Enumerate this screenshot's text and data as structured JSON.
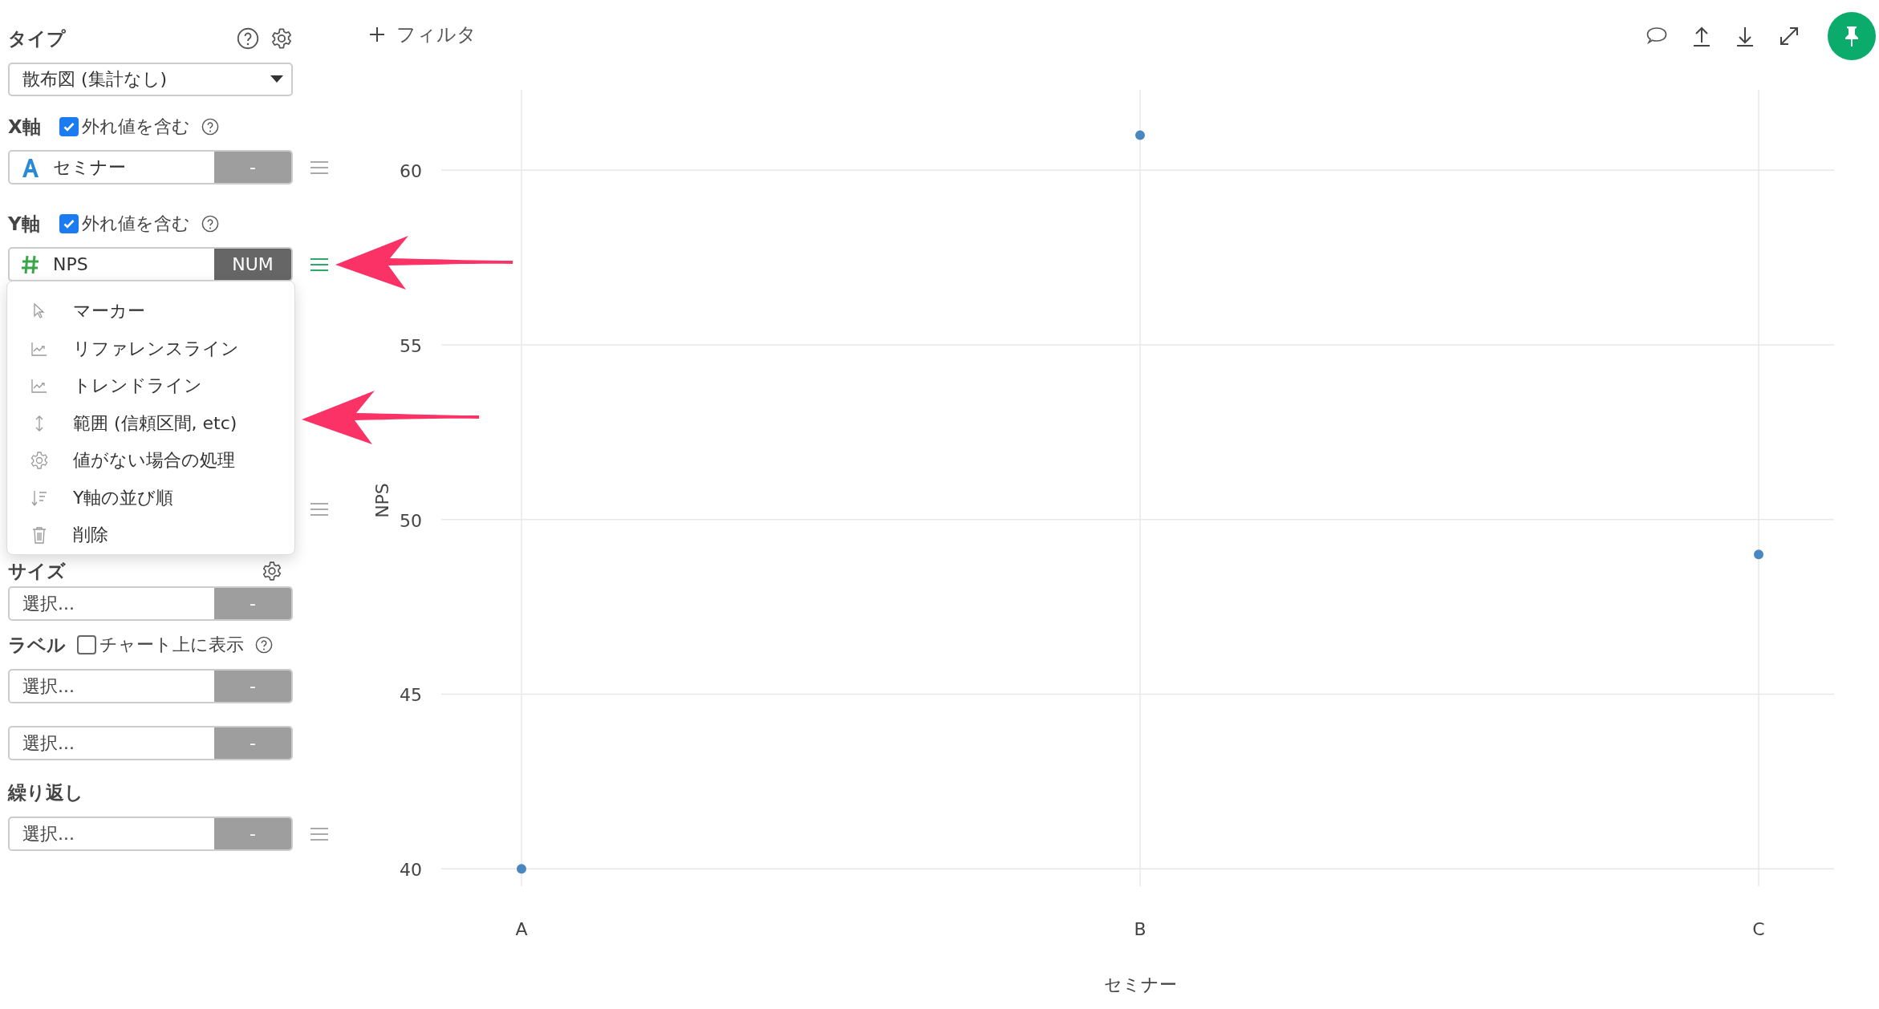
{
  "sidebar": {
    "sections": [
      {
        "kind": "type",
        "title": "タイプ",
        "dropdown": "散布図 (集計なし)"
      },
      {
        "kind": "axis",
        "title": "X軸",
        "checkbox": {
          "label": "外れ値を含む",
          "checked": true
        },
        "fields": [
          {
            "kind": "text",
            "value": "セミナー",
            "tag": "-",
            "selected": false
          }
        ]
      },
      {
        "kind": "axis",
        "title": "Y軸",
        "checkbox": {
          "label": "外れ値を含む",
          "checked": true
        },
        "fields": [
          {
            "kind": "number",
            "value": "NPS",
            "tag": "NUM",
            "selected": true
          }
        ]
      },
      {
        "kind": "size",
        "title": "サイズ",
        "fields": [
          {
            "placeholder": "選択...",
            "tag": "-",
            "selected": false
          }
        ]
      },
      {
        "kind": "label",
        "title": "ラベル",
        "checkbox": {
          "label": "チャート上に表示",
          "checked": false
        },
        "fields": [
          {
            "placeholder": "選択...",
            "tag": "-",
            "selected": false
          },
          {
            "placeholder": "選択...",
            "tag": "-",
            "selected": false
          }
        ]
      },
      {
        "kind": "repeat",
        "title": "繰り返し",
        "fields": [
          {
            "placeholder": "選択...",
            "tag": "-",
            "selected": false
          }
        ]
      }
    ]
  },
  "menu": {
    "items": [
      {
        "kind": "pointer",
        "label": "マーカー"
      },
      {
        "kind": "chart",
        "label": "リファレンスライン"
      },
      {
        "kind": "chart",
        "label": "トレンドライン"
      },
      {
        "kind": "range",
        "label": "範囲 (信頼区間, etc)"
      },
      {
        "kind": "gear",
        "label": "値がない場合の処理"
      },
      {
        "kind": "sort",
        "label": "Y軸の並び順"
      },
      {
        "kind": "trash",
        "label": "削除"
      }
    ]
  },
  "toolbar": {
    "filter": "フィルタ"
  },
  "chart": {
    "chart_data": {
      "type": "scatter",
      "xlabel": "セミナー",
      "ylabel": "NPS",
      "categories": [
        "A",
        "B",
        "C"
      ],
      "ylim": [
        39.5,
        62.3
      ],
      "yticks": [
        40,
        45,
        50,
        55,
        60
      ],
      "grid": true,
      "series": [
        {
          "color": "#4a86c0",
          "values": [
            40,
            61,
            49
          ]
        }
      ]
    }
  }
}
